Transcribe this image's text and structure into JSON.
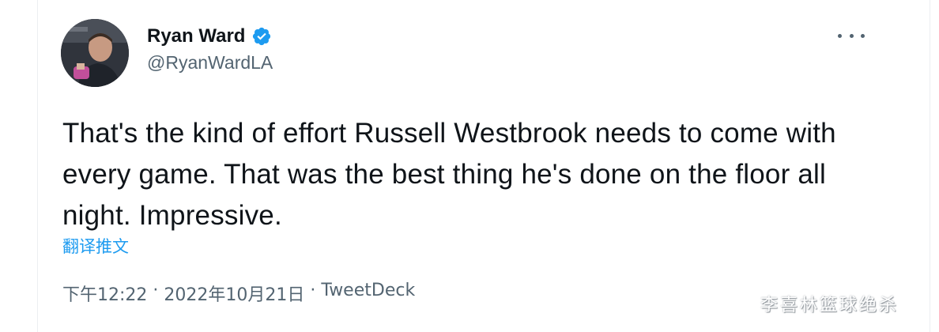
{
  "tweet": {
    "author": {
      "display_name": "Ryan Ward",
      "handle": "@RyanWardLA",
      "verified": true,
      "verified_icon": "verified-badge-icon",
      "avatar_icon": "avatar-photo"
    },
    "more_icon": "more-horizontal-icon",
    "text": "That's the kind of effort Russell Westbrook needs to come with every game. That was the best thing he's done on the floor all night. Impressive.",
    "translate_label": "翻译推文",
    "time": "下午12:22",
    "separator": "·",
    "date": "2022年10月21日",
    "source": "TweetDeck"
  },
  "watermark": "李喜林篮球绝杀",
  "colors": {
    "link": "#1d9bf0",
    "secondary_text": "#536471",
    "primary_text": "#0f1419",
    "verified": "#1d9bf0"
  }
}
